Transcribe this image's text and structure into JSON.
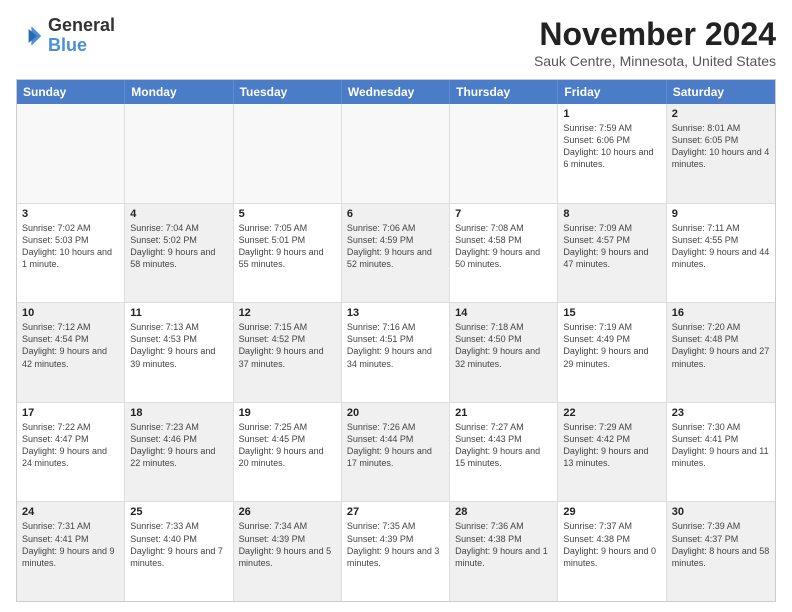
{
  "logo": {
    "line1": "General",
    "line2": "Blue"
  },
  "title": "November 2024",
  "location": "Sauk Centre, Minnesota, United States",
  "header_days": [
    "Sunday",
    "Monday",
    "Tuesday",
    "Wednesday",
    "Thursday",
    "Friday",
    "Saturday"
  ],
  "rows": [
    [
      {
        "num": "",
        "info": "",
        "empty": true
      },
      {
        "num": "",
        "info": "",
        "empty": true
      },
      {
        "num": "",
        "info": "",
        "empty": true
      },
      {
        "num": "",
        "info": "",
        "empty": true
      },
      {
        "num": "",
        "info": "",
        "empty": true
      },
      {
        "num": "1",
        "info": "Sunrise: 7:59 AM\nSunset: 6:06 PM\nDaylight: 10 hours and 6 minutes.",
        "empty": false
      },
      {
        "num": "2",
        "info": "Sunrise: 8:01 AM\nSunset: 6:05 PM\nDaylight: 10 hours and 4 minutes.",
        "empty": false,
        "shaded": true
      }
    ],
    [
      {
        "num": "3",
        "info": "Sunrise: 7:02 AM\nSunset: 5:03 PM\nDaylight: 10 hours and 1 minute.",
        "empty": false
      },
      {
        "num": "4",
        "info": "Sunrise: 7:04 AM\nSunset: 5:02 PM\nDaylight: 9 hours and 58 minutes.",
        "empty": false,
        "shaded": true
      },
      {
        "num": "5",
        "info": "Sunrise: 7:05 AM\nSunset: 5:01 PM\nDaylight: 9 hours and 55 minutes.",
        "empty": false
      },
      {
        "num": "6",
        "info": "Sunrise: 7:06 AM\nSunset: 4:59 PM\nDaylight: 9 hours and 52 minutes.",
        "empty": false,
        "shaded": true
      },
      {
        "num": "7",
        "info": "Sunrise: 7:08 AM\nSunset: 4:58 PM\nDaylight: 9 hours and 50 minutes.",
        "empty": false
      },
      {
        "num": "8",
        "info": "Sunrise: 7:09 AM\nSunset: 4:57 PM\nDaylight: 9 hours and 47 minutes.",
        "empty": false,
        "shaded": true
      },
      {
        "num": "9",
        "info": "Sunrise: 7:11 AM\nSunset: 4:55 PM\nDaylight: 9 hours and 44 minutes.",
        "empty": false
      }
    ],
    [
      {
        "num": "10",
        "info": "Sunrise: 7:12 AM\nSunset: 4:54 PM\nDaylight: 9 hours and 42 minutes.",
        "empty": false,
        "shaded": true
      },
      {
        "num": "11",
        "info": "Sunrise: 7:13 AM\nSunset: 4:53 PM\nDaylight: 9 hours and 39 minutes.",
        "empty": false
      },
      {
        "num": "12",
        "info": "Sunrise: 7:15 AM\nSunset: 4:52 PM\nDaylight: 9 hours and 37 minutes.",
        "empty": false,
        "shaded": true
      },
      {
        "num": "13",
        "info": "Sunrise: 7:16 AM\nSunset: 4:51 PM\nDaylight: 9 hours and 34 minutes.",
        "empty": false
      },
      {
        "num": "14",
        "info": "Sunrise: 7:18 AM\nSunset: 4:50 PM\nDaylight: 9 hours and 32 minutes.",
        "empty": false,
        "shaded": true
      },
      {
        "num": "15",
        "info": "Sunrise: 7:19 AM\nSunset: 4:49 PM\nDaylight: 9 hours and 29 minutes.",
        "empty": false
      },
      {
        "num": "16",
        "info": "Sunrise: 7:20 AM\nSunset: 4:48 PM\nDaylight: 9 hours and 27 minutes.",
        "empty": false,
        "shaded": true
      }
    ],
    [
      {
        "num": "17",
        "info": "Sunrise: 7:22 AM\nSunset: 4:47 PM\nDaylight: 9 hours and 24 minutes.",
        "empty": false
      },
      {
        "num": "18",
        "info": "Sunrise: 7:23 AM\nSunset: 4:46 PM\nDaylight: 9 hours and 22 minutes.",
        "empty": false,
        "shaded": true
      },
      {
        "num": "19",
        "info": "Sunrise: 7:25 AM\nSunset: 4:45 PM\nDaylight: 9 hours and 20 minutes.",
        "empty": false
      },
      {
        "num": "20",
        "info": "Sunrise: 7:26 AM\nSunset: 4:44 PM\nDaylight: 9 hours and 17 minutes.",
        "empty": false,
        "shaded": true
      },
      {
        "num": "21",
        "info": "Sunrise: 7:27 AM\nSunset: 4:43 PM\nDaylight: 9 hours and 15 minutes.",
        "empty": false
      },
      {
        "num": "22",
        "info": "Sunrise: 7:29 AM\nSunset: 4:42 PM\nDaylight: 9 hours and 13 minutes.",
        "empty": false,
        "shaded": true
      },
      {
        "num": "23",
        "info": "Sunrise: 7:30 AM\nSunset: 4:41 PM\nDaylight: 9 hours and 11 minutes.",
        "empty": false
      }
    ],
    [
      {
        "num": "24",
        "info": "Sunrise: 7:31 AM\nSunset: 4:41 PM\nDaylight: 9 hours and 9 minutes.",
        "empty": false,
        "shaded": true
      },
      {
        "num": "25",
        "info": "Sunrise: 7:33 AM\nSunset: 4:40 PM\nDaylight: 9 hours and 7 minutes.",
        "empty": false
      },
      {
        "num": "26",
        "info": "Sunrise: 7:34 AM\nSunset: 4:39 PM\nDaylight: 9 hours and 5 minutes.",
        "empty": false,
        "shaded": true
      },
      {
        "num": "27",
        "info": "Sunrise: 7:35 AM\nSunset: 4:39 PM\nDaylight: 9 hours and 3 minutes.",
        "empty": false
      },
      {
        "num": "28",
        "info": "Sunrise: 7:36 AM\nSunset: 4:38 PM\nDaylight: 9 hours and 1 minute.",
        "empty": false,
        "shaded": true
      },
      {
        "num": "29",
        "info": "Sunrise: 7:37 AM\nSunset: 4:38 PM\nDaylight: 9 hours and 0 minutes.",
        "empty": false
      },
      {
        "num": "30",
        "info": "Sunrise: 7:39 AM\nSunset: 4:37 PM\nDaylight: 8 hours and 58 minutes.",
        "empty": false,
        "shaded": true
      }
    ]
  ]
}
